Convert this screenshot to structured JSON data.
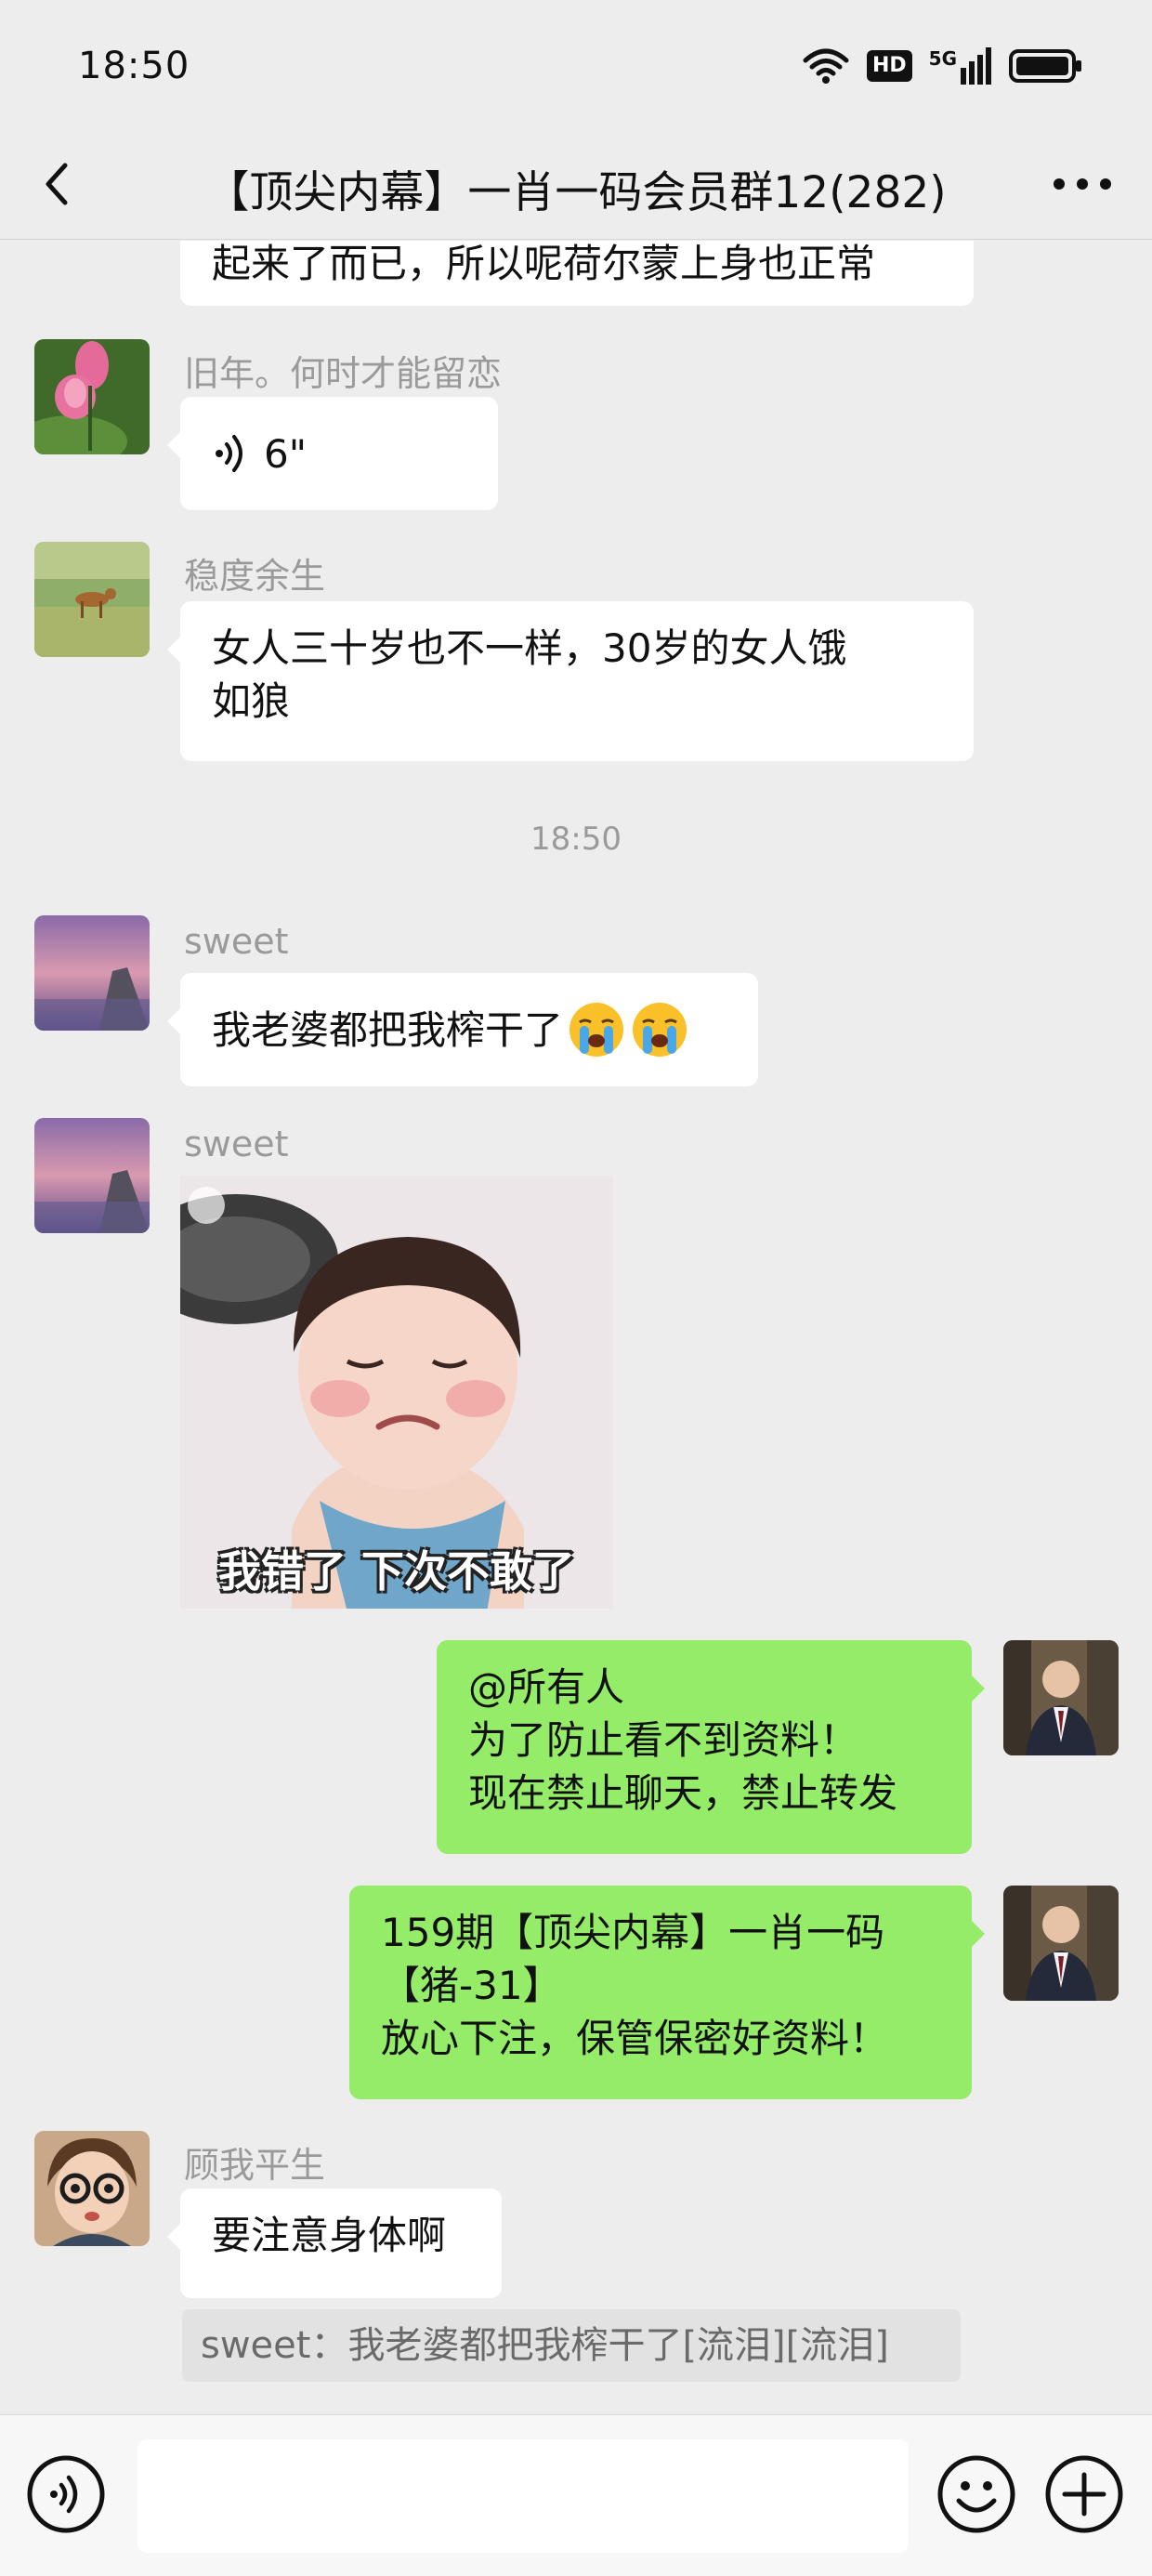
{
  "status_bar": {
    "time": "18:50",
    "hd_label": "HD",
    "network_label": "5G",
    "icons": [
      "wifi-icon",
      "hd-icon",
      "signal-icon",
      "battery-icon"
    ]
  },
  "nav": {
    "title": "【顶尖内幕】一肖一码会员群12(282)",
    "back_icon": "chevron-left-icon",
    "more_icon": "more-dots-icon"
  },
  "messages": [
    {
      "id": "m0",
      "side": "left",
      "partial": true,
      "text": "起来了而已，所以呢荷尔蒙上身也正常"
    },
    {
      "id": "m1",
      "side": "left",
      "sender": "旧年。何时才能留恋",
      "type": "voice",
      "duration": "6\""
    },
    {
      "id": "m2",
      "side": "left",
      "sender": "稳度余生",
      "lines": [
        "女人三十岁也不一样，30岁的女人饿",
        "如狼"
      ]
    },
    {
      "id": "t1",
      "type": "timestamp",
      "text": "18:50"
    },
    {
      "id": "m3",
      "side": "left",
      "sender": "sweet",
      "text": "我老婆都把我榨干了",
      "emojis": [
        "😭",
        "😭"
      ]
    },
    {
      "id": "m4",
      "side": "left",
      "sender": "sweet",
      "type": "sticker",
      "caption": "我错了 下次不敢了"
    },
    {
      "id": "m5",
      "side": "right",
      "lines": [
        "@所有人",
        "为了防止看不到资料！",
        "现在禁止聊天，禁止转发"
      ]
    },
    {
      "id": "m6",
      "side": "right",
      "lines": [
        "159期【顶尖内幕】一肖一码",
        "【猪-31】",
        "放心下注，保管保密好资料！"
      ]
    },
    {
      "id": "m7",
      "side": "left",
      "sender": "顾我平生",
      "text": "要注意身体啊"
    },
    {
      "id": "q1",
      "type": "quote",
      "text": "sweet：我老婆都把我榨干了[流泪][流泪]"
    }
  ],
  "input_bar": {
    "voice_icon": "voice-icon",
    "emoji_icon": "emoji-icon",
    "plus_icon": "plus-icon"
  },
  "colors": {
    "background": "#ededed",
    "bubble_self": "#95ec69",
    "bubble_other": "#ffffff",
    "meta_text": "#9a9a9a"
  }
}
